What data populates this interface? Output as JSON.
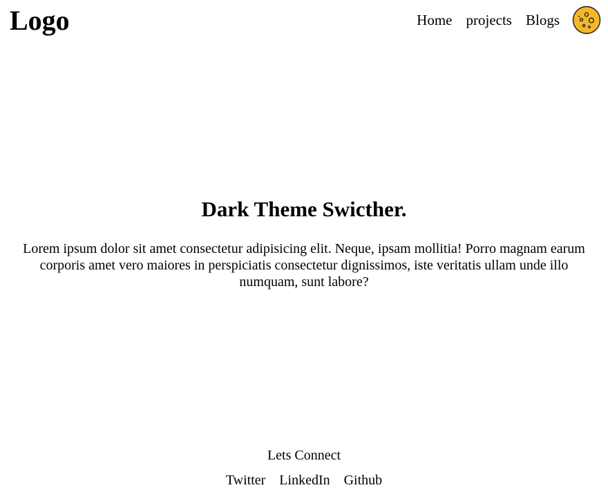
{
  "header": {
    "logo": "Logo",
    "nav": [
      {
        "label": "Home"
      },
      {
        "label": "projects"
      },
      {
        "label": "Blogs"
      }
    ],
    "theme_toggle_icon": "moon-icon",
    "theme_toggle_color": "#f4b728"
  },
  "hero": {
    "title": "Dark Theme Swicther.",
    "body": "Lorem ipsum dolor sit amet consectetur adipisicing elit. Neque, ipsam mollitia! Porro magnam earum corporis amet vero maiores in perspiciatis consectetur dignissimos, iste veritatis ullam unde illo numquam, sunt labore?"
  },
  "footer": {
    "heading": "Lets Connect",
    "links": [
      {
        "label": "Twitter"
      },
      {
        "label": "LinkedIn"
      },
      {
        "label": "Github"
      }
    ]
  }
}
